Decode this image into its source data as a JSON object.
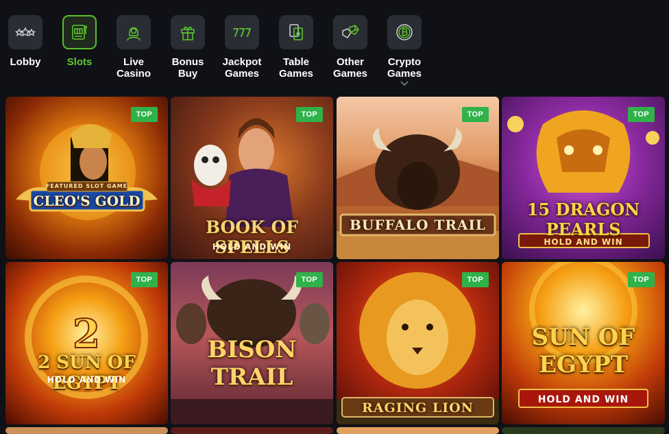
{
  "nav": {
    "items": [
      {
        "label": "Lobby",
        "icon": "stars-icon"
      },
      {
        "label": "Slots",
        "icon": "slot-machine-icon",
        "active": true
      },
      {
        "label": "Live\nCasino",
        "icon": "dealer-icon"
      },
      {
        "label": "Bonus\nBuy",
        "icon": "gift-icon"
      },
      {
        "label": "Jackpot\nGames",
        "icon": "seven-seven-seven-icon"
      },
      {
        "label": "Table\nGames",
        "icon": "cards-icon"
      },
      {
        "label": "Other\nGames",
        "icon": "dice-icon"
      },
      {
        "label": "Crypto\nGames",
        "icon": "bitcoin-icon"
      }
    ],
    "active_color": "#5dc92d"
  },
  "games": [
    {
      "title": "CLEO'S GOLD",
      "subtitle": "FEATURED SLOT GAME",
      "badge": "TOP"
    },
    {
      "title": "BOOK OF SPELLS",
      "subtitle": "HOLD AND WIN",
      "badge": "TOP"
    },
    {
      "title": "BUFFALO TRAIL",
      "subtitle": "",
      "badge": "TOP"
    },
    {
      "title": "15 DRAGON PEARLS",
      "subtitle": "HOLD AND WIN",
      "badge": "TOP"
    },
    {
      "title": "2 SUN OF EGYPT",
      "subtitle": "HOLD AND WIN",
      "badge": "TOP"
    },
    {
      "title": "BISON TRAIL",
      "subtitle": "",
      "badge": "TOP"
    },
    {
      "title": "RAGING LION",
      "subtitle": "",
      "badge": "TOP"
    },
    {
      "title": "SUN OF EGYPT",
      "subtitle": "HOLD AND WIN",
      "badge": "TOP"
    }
  ]
}
